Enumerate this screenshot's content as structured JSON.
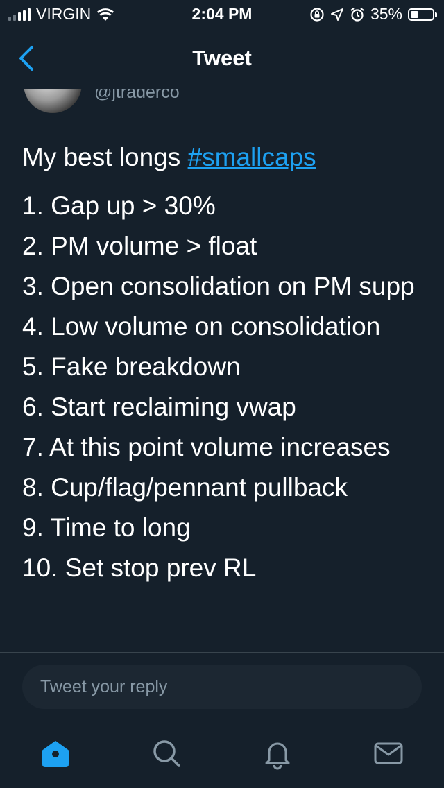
{
  "status": {
    "carrier": "VIRGIN",
    "time": "2:04 PM",
    "battery_percent": "35%",
    "battery_level": 0.35
  },
  "nav": {
    "title": "Tweet"
  },
  "tweet": {
    "handle": "@jtraderco",
    "intro": "My best longs ",
    "hashtag": "#smallcaps",
    "lines": [
      "1. Gap up > 30%",
      "2. PM volume > float",
      "3. Open consolidation on PM supp",
      "4. Low volume on consolidation",
      "5. Fake breakdown",
      "6. Start reclaiming vwap",
      "7. At this point volume increases",
      "8. Cup/flag/pennant pullback",
      "9. Time to long",
      "10. Set stop prev RL"
    ]
  },
  "reply": {
    "placeholder": "Tweet your reply"
  },
  "tabs": [
    {
      "icon": "home-icon",
      "active": true
    },
    {
      "icon": "search-icon",
      "active": false
    },
    {
      "icon": "bell-icon",
      "active": false
    },
    {
      "icon": "mail-icon",
      "active": false
    }
  ],
  "colors": {
    "background": "#15202b",
    "accent": "#1da1f2",
    "muted": "#8899a6"
  }
}
